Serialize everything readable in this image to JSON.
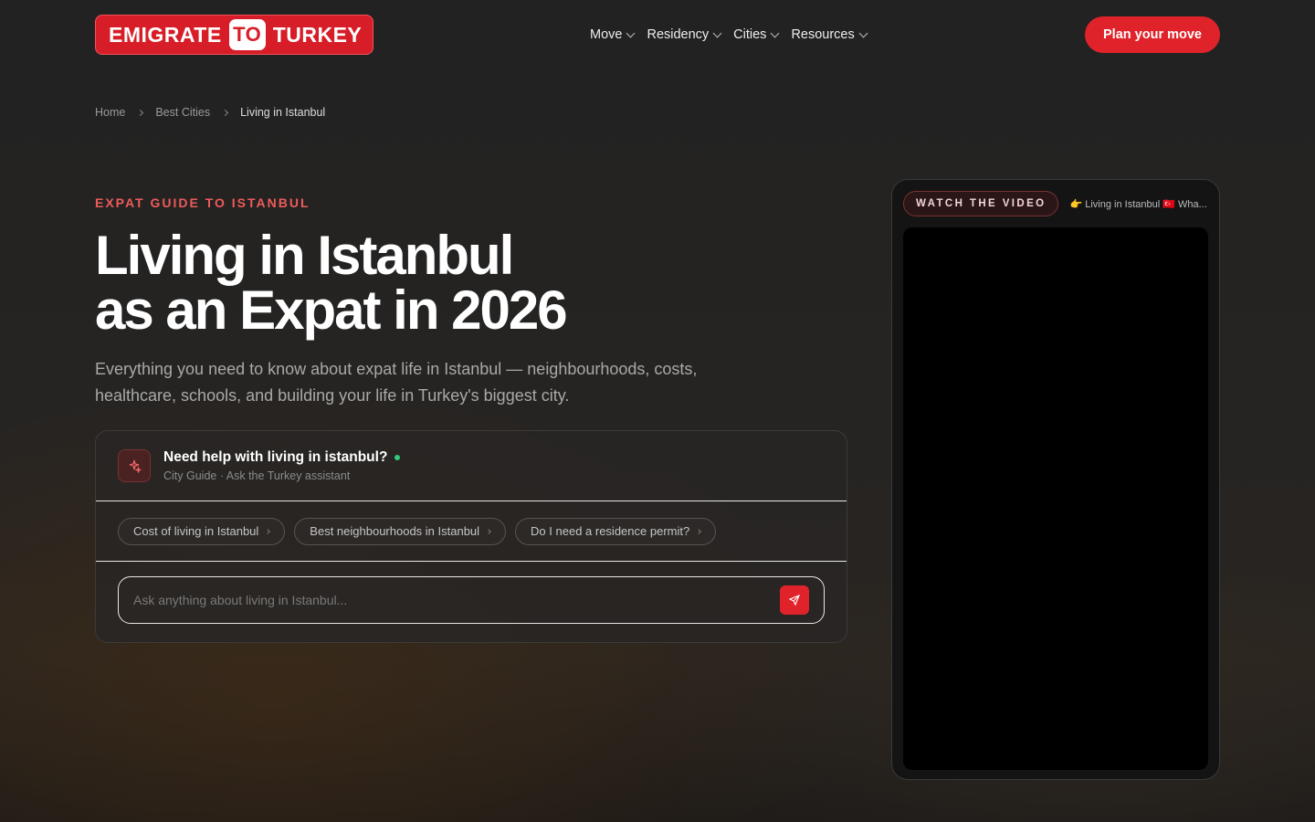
{
  "header": {
    "logo_left": "EMIGRATE",
    "logo_mid": "TO",
    "logo_right": "TURKEY",
    "nav": [
      "Move",
      "Residency",
      "Cities",
      "Resources"
    ],
    "cta": "Plan your move"
  },
  "breadcrumb": [
    "Home",
    "Best Cities",
    "Living in Istanbul"
  ],
  "hero": {
    "eyebrow": "EXPAT GUIDE TO ISTANBUL",
    "title_line1": "Living in Istanbul",
    "title_line2": "as an Expat in 2026",
    "subtitle": "Everything you need to know about expat life in Istanbul — neighbourhoods, costs, healthcare, schools, and building your life in Turkey's biggest city."
  },
  "assistant": {
    "title": "Need help with living in istanbul?",
    "subtitle": "City Guide · Ask the Turkey assistant",
    "chips": [
      "Cost of living in Istanbul",
      "Best neighbourhoods in Istanbul",
      "Do I need a residence permit?"
    ],
    "placeholder": "Ask anything about living in Istanbul..."
  },
  "video": {
    "label": "WATCH THE VIDEO",
    "caption": "👉 Living in Istanbul 🇹🇷 Wha..."
  },
  "colors": {
    "accent": "#e0232b",
    "online": "#32c97a"
  }
}
